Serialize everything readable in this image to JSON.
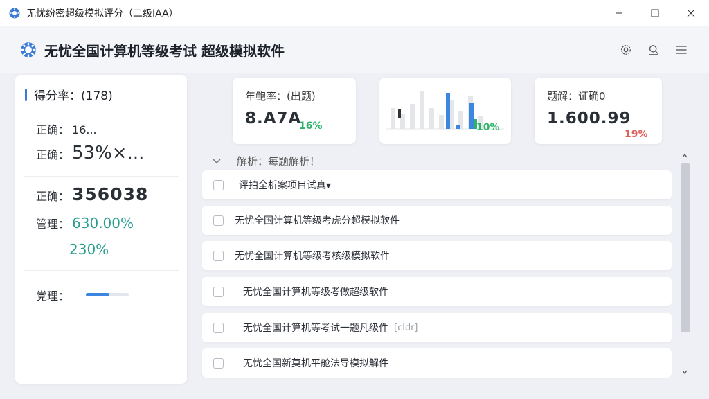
{
  "window": {
    "title": "无忧纷密超级模拟评分（二级IAA）",
    "icon": "gear-logo-icon"
  },
  "header": {
    "app_name": "无忧全国计算机等级考试 超级模拟软件",
    "tools": [
      "settings-icon",
      "search-icon",
      "menu-icon"
    ]
  },
  "left_panel": {
    "title": "得分率：(178)",
    "row1": {
      "label": "正确：",
      "value": "16..."
    },
    "row2": {
      "label": "正确：",
      "value": "53%×..."
    },
    "row3": {
      "label": "正确：",
      "value": "356038"
    },
    "row4": {
      "label": "管理：",
      "value": "630.00%"
    },
    "row5": {
      "value": "230%"
    },
    "row6": {
      "label": "党理：",
      "progress": 0.55
    }
  },
  "cards": [
    {
      "label": "年鲍率：(出题)",
      "value": "8.A7A",
      "pct": "16%",
      "pct_color": "#2fb36b"
    },
    {
      "label": "",
      "value": "",
      "pct": "10%",
      "pct_color": "#2fb36b"
    },
    {
      "label": "题解：证确0",
      "value": "1.600.99",
      "pct": "19%",
      "pct_color": "#e0605a"
    }
  ],
  "list": {
    "header": "解析：每题解析！",
    "rows": [
      {
        "text": "评拍全析案项目试真▾",
        "tag": ""
      },
      {
        "text": "无忧全国计算机等级考虎分超模拟软件",
        "tag": ""
      },
      {
        "text": "无忧全国计算机等级考核级模拟软件",
        "tag": ""
      },
      {
        "text": "无忧全国计算机等级考做超级软件",
        "tag": ""
      },
      {
        "text": "无忧全国计算机等考试一题凡级件",
        "tag": "[cldr]"
      },
      {
        "text": "无忧全国新莫机平舱法导模拟解件",
        "tag": ""
      }
    ]
  },
  "colors": {
    "accent": "#3a7bd5",
    "teal": "#2a9d8f",
    "green": "#2fb36b",
    "red": "#e0605a"
  }
}
